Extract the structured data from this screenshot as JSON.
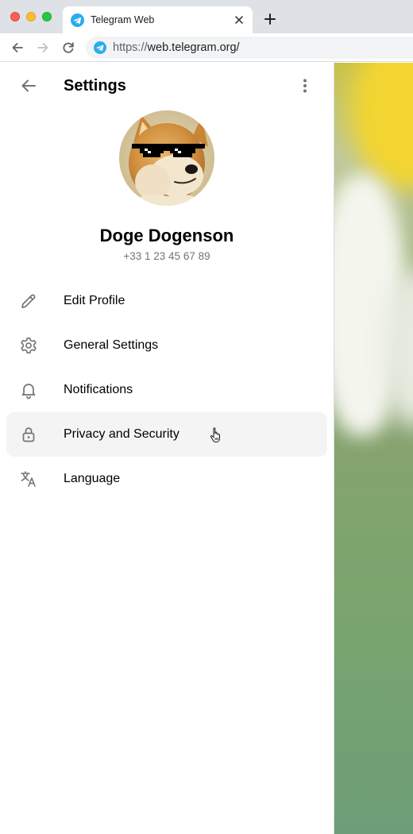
{
  "browser": {
    "tab": {
      "title": "Telegram Web",
      "favicon": "telegram-icon"
    },
    "url": {
      "scheme": "https://",
      "host": "web.telegram.org/"
    }
  },
  "settings": {
    "title": "Settings",
    "profile": {
      "name": "Doge Dogenson",
      "phone": "+33 1 23 45 67 89",
      "avatar": "doge-with-pixel-sunglasses"
    },
    "menu": [
      {
        "label": "Edit Profile",
        "icon": "pencil-icon"
      },
      {
        "label": "General Settings",
        "icon": "gear-icon"
      },
      {
        "label": "Notifications",
        "icon": "bell-icon"
      },
      {
        "label": "Privacy and Security",
        "icon": "lock-icon",
        "highlighted": true
      },
      {
        "label": "Language",
        "icon": "translate-icon"
      }
    ]
  },
  "colors": {
    "telegram_blue": "#2aabee",
    "secondary_text": "#707579",
    "highlight_bg": "#f4f4f5"
  }
}
